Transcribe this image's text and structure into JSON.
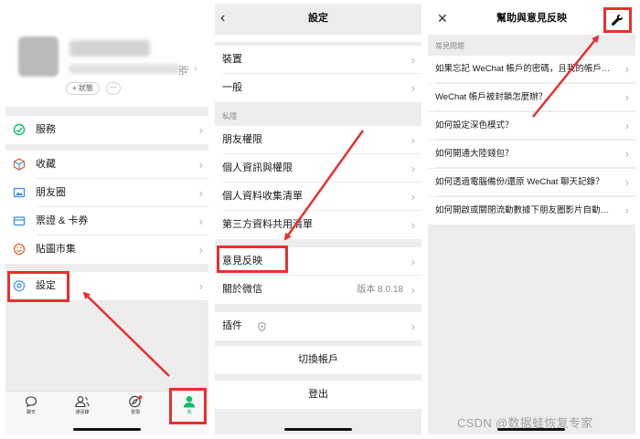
{
  "panel1": {
    "status_button": "+ 狀態",
    "more_button": "···",
    "menu": [
      {
        "label": "服務",
        "icon": "service-icon"
      },
      {
        "label": "收藏",
        "icon": "favorites-icon"
      },
      {
        "label": "朋友圈",
        "icon": "moments-icon"
      },
      {
        "label": "票證 & 卡券",
        "icon": "cards-icon"
      },
      {
        "label": "貼圖市集",
        "icon": "sticker-icon"
      },
      {
        "label": "設定",
        "icon": "settings-gear-icon"
      }
    ],
    "tabs": [
      {
        "label": "聊天",
        "icon": "chat-icon"
      },
      {
        "label": "通訊錄",
        "icon": "contacts-icon"
      },
      {
        "label": "發現",
        "icon": "discover-icon"
      },
      {
        "label": "我",
        "icon": "me-icon"
      }
    ]
  },
  "panel2": {
    "title": "設定",
    "rows_top": [
      "裝置",
      "一般"
    ],
    "privacy_section": "私隱",
    "privacy_rows": [
      "朋友權限",
      "個人資訊與權限",
      "個人資料收集清單",
      "第三方資料共用清單"
    ],
    "feedback": "意見反映",
    "about": {
      "label": "關於微信",
      "value": "版本 8.0.18"
    },
    "plugins": "插件",
    "switch_account": "切換帳戶",
    "logout": "登出"
  },
  "panel3": {
    "title": "幫助與意見反映",
    "section": "常見問題",
    "faqs": [
      "如果忘記 WeChat 帳戶的密碼，且我的帳戶沒…",
      "WeChat 帳戶被封鎖怎麼辦？",
      "如何設定深色模式？",
      "如何開通大陸錢包？",
      "如何透過電腦備份/還原 WeChat 聊天記錄？",
      "如何開啟或關閉流動數據下朋友圈影片自動播…"
    ]
  },
  "watermark": "CSDN @数据蛙恢复专家",
  "colors": {
    "accent_green": "#07c160",
    "annotation_red": "#e8302e",
    "background_gray": "#ededed"
  }
}
